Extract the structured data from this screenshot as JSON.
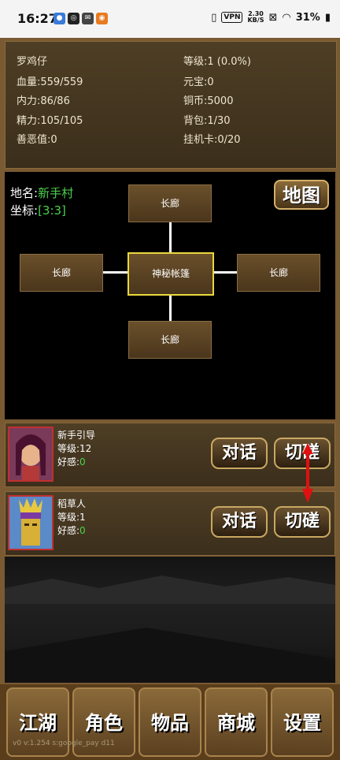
{
  "status_bar": {
    "time": "16:27",
    "apps": [
      "cc-icon",
      "swirl-icon",
      "mail-icon",
      "rss-icon"
    ],
    "vpn": "VPN",
    "speed_value": "2.30",
    "speed_unit": "KB/S",
    "battery": "31%"
  },
  "player": {
    "name": "罗鸡仔",
    "hp": "血量:559/559",
    "mp": "内力:86/86",
    "stamina": "精力:105/105",
    "karma": "善恶值:0",
    "level": "等级:1 (0.0%)",
    "yuanbao": "元宝:0",
    "copper": "铜币:5000",
    "bag": "背包:1/30",
    "hangcard": "挂机卡:0/20"
  },
  "location": {
    "place_label": "地名:",
    "place_value": "新手村",
    "coord_label": "坐标:",
    "coord_value": "[3:3]"
  },
  "map_button": "地图",
  "rooms": {
    "north": "长廊",
    "west": "长廊",
    "center": "神秘帐篷",
    "east": "长廊",
    "south": "长廊"
  },
  "npcs": [
    {
      "name": "新手引导",
      "level": "等级:12",
      "fav_label": "好感:",
      "fav_value": "0",
      "talk": "对话",
      "spar": "切磋"
    },
    {
      "name": "稻草人",
      "level": "等级:1",
      "fav_label": "好感:",
      "fav_value": "0",
      "talk": "对话",
      "spar": "切磋"
    }
  ],
  "tabs": [
    "江湖",
    "角色",
    "物品",
    "商城",
    "设置"
  ],
  "version": "v0 v:1.254 s:google_pay d11",
  "colors": {
    "accent_green": "#4cd14c",
    "gold_border": "#e8d83c",
    "frame_brown": "#7a5a32"
  }
}
